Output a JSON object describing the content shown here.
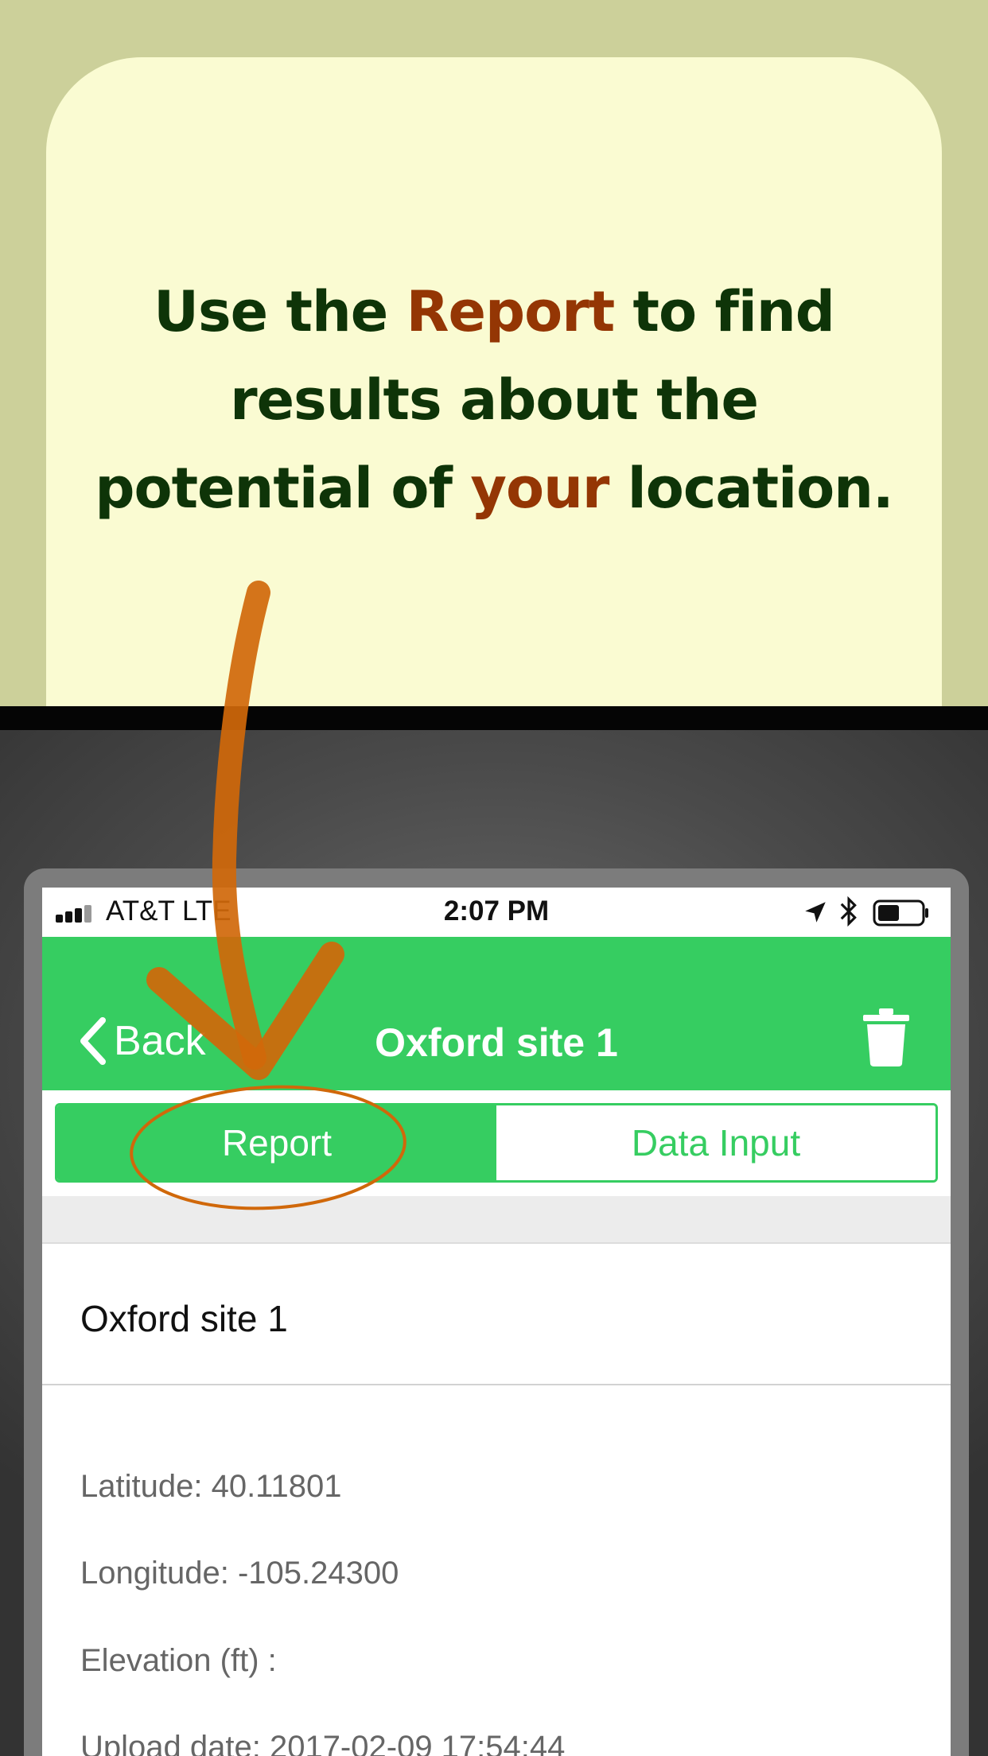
{
  "caption": {
    "line1_before": "Use the ",
    "line1_highlight": "Report",
    "line1_after": " to find",
    "line2": "results about the",
    "line3_before": "potential of ",
    "line3_highlight": "your",
    "line3_after": " location."
  },
  "status_bar": {
    "carrier": "AT&T  LTE",
    "time": "2:07 PM"
  },
  "nav": {
    "back_label": "Back",
    "title": "Oxford site 1"
  },
  "segments": {
    "report_label": "Report",
    "data_input_label": "Data Input",
    "selected": "Report"
  },
  "site": {
    "name": "Oxford site 1",
    "latitude": "Latitude: 40.11801",
    "longitude": "Longitude: -105.24300",
    "elevation": "Elevation (ft) :",
    "upload_date": "Upload date: 2017-02-09 17:54:44"
  },
  "colors": {
    "background_top": "#ccd09a",
    "caption_card": "#fafbd2",
    "caption_text": "#0e3408",
    "caption_highlight": "#943604",
    "accent_green": "#36cd61",
    "annotation_orange": "#d0680a"
  },
  "icons": {
    "back": "chevron-left-icon",
    "trash": "trash-icon",
    "location": "location-arrow-icon",
    "bluetooth": "bluetooth-icon",
    "battery": "battery-icon",
    "signal": "signal-icon",
    "annotation_arrow": "arrow-annotation",
    "annotation_circle": "circle-annotation"
  }
}
